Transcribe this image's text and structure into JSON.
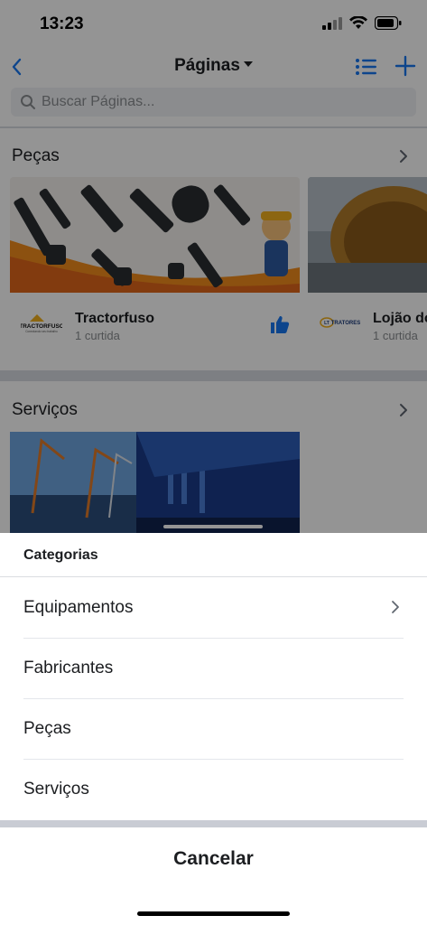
{
  "status_bar": {
    "time": "13:23"
  },
  "nav": {
    "title": "Páginas",
    "back_icon": "chevron-left-icon",
    "list_icon": "list-icon",
    "add_icon": "plus-icon"
  },
  "search": {
    "placeholder": "Buscar Páginas..."
  },
  "sections": [
    {
      "title": "Peças",
      "cards": [
        {
          "name": "Tractorfuso",
          "likes": "1 curtida",
          "logo_text": "TRACTORFUSO",
          "logo_subtext": "Conectando seu trabalho"
        },
        {
          "name": "Lojão dos",
          "likes": "1 curtida",
          "logo_text": "LT TRATORES"
        }
      ]
    },
    {
      "title": "Serviços"
    }
  ],
  "sheet": {
    "title": "Categorias",
    "items": [
      {
        "label": "Equipamentos",
        "has_submenu": true
      },
      {
        "label": "Fabricantes",
        "has_submenu": false
      },
      {
        "label": "Peças",
        "has_submenu": false
      },
      {
        "label": "Serviços",
        "has_submenu": false
      }
    ],
    "cancel_label": "Cancelar"
  },
  "colors": {
    "accent": "#1877f2",
    "text": "#1c1e21",
    "secondary_text": "#8a8d91"
  }
}
